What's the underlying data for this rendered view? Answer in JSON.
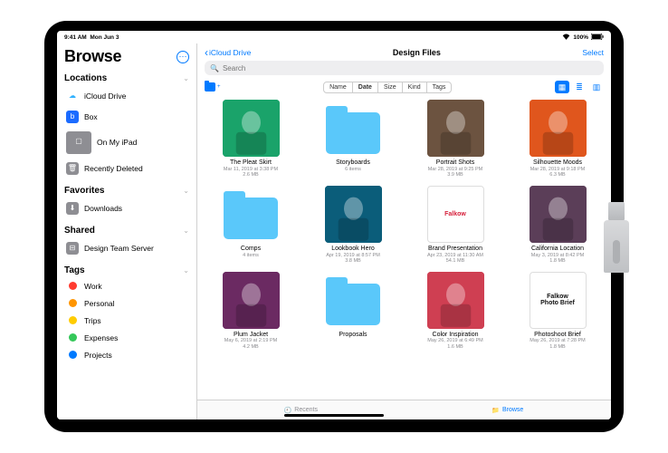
{
  "status": {
    "time": "9:41 AM",
    "date": "Mon Jun 3",
    "battery_pct": "100%"
  },
  "sidebar": {
    "title": "Browse",
    "sections": {
      "locations": {
        "label": "Locations",
        "items": [
          {
            "label": "iCloud Drive"
          },
          {
            "label": "Box"
          },
          {
            "label": "On My iPad"
          },
          {
            "label": "Recently Deleted"
          }
        ]
      },
      "favorites": {
        "label": "Favorites",
        "items": [
          {
            "label": "Downloads"
          }
        ]
      },
      "shared": {
        "label": "Shared",
        "items": [
          {
            "label": "Design Team Server"
          }
        ]
      },
      "tags": {
        "label": "Tags",
        "items": [
          {
            "label": "Work",
            "color": "#ff3b30"
          },
          {
            "label": "Personal",
            "color": "#ff9500"
          },
          {
            "label": "Trips",
            "color": "#ffcc00"
          },
          {
            "label": "Expenses",
            "color": "#34c759"
          },
          {
            "label": "Projects",
            "color": "#007aff"
          }
        ]
      }
    }
  },
  "nav": {
    "back": "iCloud Drive",
    "title": "Design Files",
    "select": "Select"
  },
  "search": {
    "placeholder": "Search"
  },
  "sort": {
    "options": [
      "Name",
      "Date",
      "Size",
      "Kind",
      "Tags"
    ],
    "selected": "Date"
  },
  "files": [
    {
      "name": "The Pleat Skirt",
      "meta1": "Mar 11, 2019 at 3:38 PM",
      "meta2": "2.6 MB",
      "kind": "image",
      "swatch": "#1aa36a"
    },
    {
      "name": "Storyboards",
      "meta1": "6 items",
      "meta2": "",
      "kind": "folder"
    },
    {
      "name": "Portrait Shots",
      "meta1": "Mar 28, 2019 at 9:25 PM",
      "meta2": "3.9 MB",
      "kind": "image",
      "swatch": "#6c5340"
    },
    {
      "name": "Silhouette Moods",
      "meta1": "Mar 28, 2019 at 9:18 PM",
      "meta2": "6.3 MB",
      "kind": "image",
      "swatch": "#e0561d"
    },
    {
      "name": "Comps",
      "meta1": "4 items",
      "meta2": "",
      "kind": "folder"
    },
    {
      "name": "Lookbook Hero",
      "meta1": "Apr 19, 2019 at 8:57 PM",
      "meta2": "3.8 MB",
      "kind": "image",
      "swatch": "#0b5d7a"
    },
    {
      "name": "Brand Presentation",
      "meta1": "Apr 23, 2019 at 11:30 AM",
      "meta2": "54.1 MB",
      "kind": "doc",
      "doc_text": "Falkow",
      "doc_color": "#d61f3a"
    },
    {
      "name": "California Location",
      "meta1": "May 3, 2019 at 8:42 PM",
      "meta2": "1.8 MB",
      "kind": "image",
      "swatch": "#5b3e58"
    },
    {
      "name": "Plum Jacket",
      "meta1": "May 6, 2019 at 2:19 PM",
      "meta2": "4.2 MB",
      "kind": "image",
      "swatch": "#6b2a62"
    },
    {
      "name": "Proposals",
      "meta1": "",
      "meta2": "",
      "kind": "folder"
    },
    {
      "name": "Color Inspiration",
      "meta1": "May 26, 2019 at 6:49 PM",
      "meta2": "1.6 MB",
      "kind": "image",
      "swatch": "#cf3f52"
    },
    {
      "name": "Photoshoot Brief",
      "meta1": "May 26, 2019 at 7:28 PM",
      "meta2": "1.8 MB",
      "kind": "doc",
      "doc_text": "Falkow\nPhoto Brief",
      "doc_color": "#111"
    }
  ],
  "tabs": {
    "recents": "Recents",
    "browse": "Browse"
  }
}
